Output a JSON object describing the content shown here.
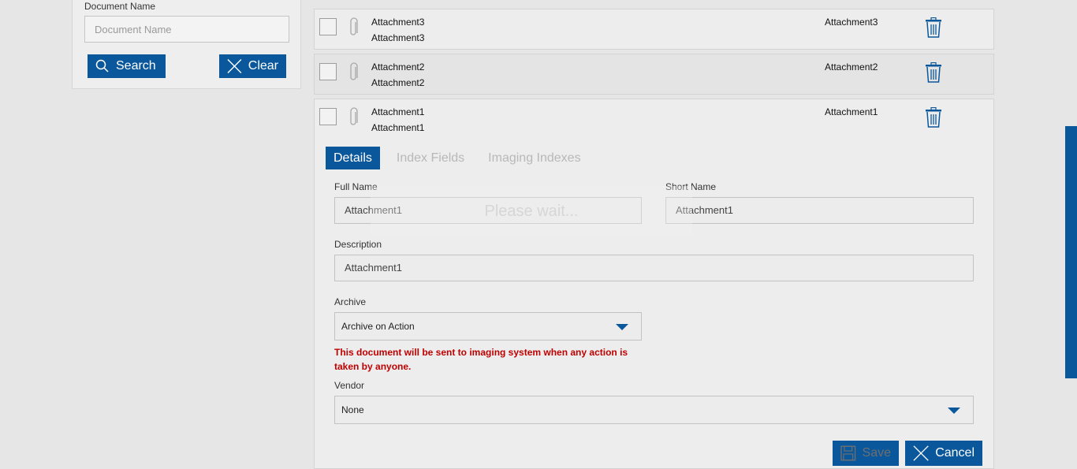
{
  "search_panel": {
    "doc_name_label": "Document Name",
    "doc_name_placeholder": "Document Name",
    "doc_name_value": "",
    "search_label": "Search",
    "clear_label": "Clear"
  },
  "attachments": [
    {
      "name": "Attachment3",
      "subtitle": "Attachment3",
      "short": "Attachment3"
    },
    {
      "name": "Attachment2",
      "subtitle": "Attachment2",
      "short": "Attachment2"
    },
    {
      "name": "Attachment1",
      "subtitle": "Attachment1",
      "short": "Attachment1"
    }
  ],
  "tabs": [
    "Details",
    "Index Fields",
    "Imaging Indexes"
  ],
  "details": {
    "full_name_label": "Full Name",
    "full_name_value": "Attachment1",
    "short_name_label": "Short Name",
    "short_name_value": "Attachment1",
    "description_label": "Description",
    "description_value": "Attachment1",
    "archive_label": "Archive",
    "archive_value": "Archive on Action",
    "archive_warning": "This document will be sent to imaging system when any action is taken by anyone.",
    "vendor_label": "Vendor",
    "vendor_value": "None"
  },
  "overlay_text": "Please wait...",
  "actions": {
    "save_label": "Save",
    "cancel_label": "Cancel"
  },
  "colors": {
    "accent": "#0a579b",
    "warning": "#c00000",
    "background": "#e6e6e6"
  }
}
